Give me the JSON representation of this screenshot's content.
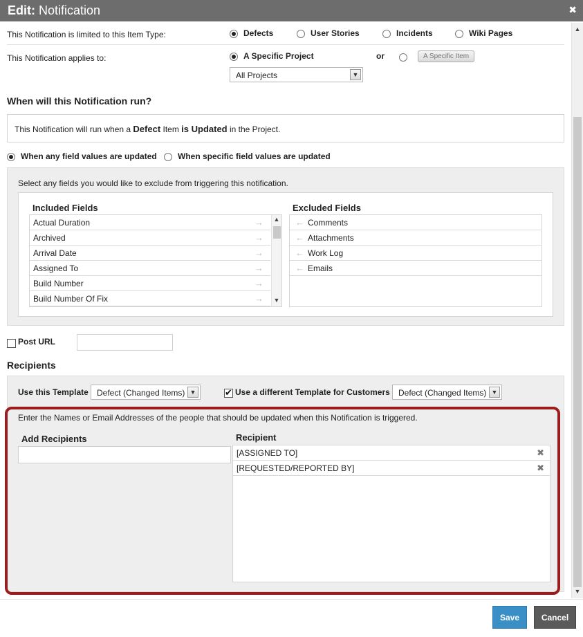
{
  "dialog": {
    "title_prefix": "Edit:",
    "title_main": "Notification",
    "close_glyph": "✖"
  },
  "item_type": {
    "label": "This Notification is limited to this Item Type:",
    "options": [
      {
        "label": "Defects",
        "selected": true
      },
      {
        "label": "User Stories",
        "selected": false
      },
      {
        "label": "Incidents",
        "selected": false
      },
      {
        "label": "Wiki Pages",
        "selected": false
      }
    ]
  },
  "applies_to": {
    "label": "This Notification applies to:",
    "specific_project": "A Specific Project",
    "or": "or",
    "specific_item_button": "A Specific Item",
    "project_select_value": "All Projects"
  },
  "when": {
    "heading": "When will this Notification run?",
    "summary_pre": "This Notification will run when a ",
    "summary_item": "Defect",
    "summary_mid": " Item ",
    "summary_event": "is Updated",
    "summary_post": " in the  Project.",
    "option_any": "When any field values are updated",
    "option_specific": "When specific field values are updated"
  },
  "fields": {
    "instructions": "Select any fields you would like to exclude from triggering this notification.",
    "included_heading": "Included Fields",
    "excluded_heading": "Excluded Fields",
    "included": [
      "Actual Duration",
      "Archived",
      "Arrival Date",
      "Assigned To",
      "Build Number",
      "Build Number Of Fix"
    ],
    "excluded": [
      "Comments",
      "Attachments",
      "Work Log",
      "Emails"
    ],
    "arrow_right": "→",
    "arrow_left": "←"
  },
  "post_url": {
    "label": "Post URL",
    "value": ""
  },
  "recipients": {
    "heading": "Recipients",
    "template_label": "Use this Template",
    "template_value": "Defect (Changed Items)",
    "customer_template_label": "Use a different Template for Customers",
    "customer_template_value": "Defect (Changed Items)",
    "instructions": "Enter the Names or Email Addresses of the people that should be updated when this Notification is triggered.",
    "add_heading": "Add Recipients",
    "list_heading": "Recipient",
    "list": [
      "[ASSIGNED TO]",
      "[REQUESTED/REPORTED BY]"
    ],
    "remove_glyph": "✖"
  },
  "footer": {
    "save": "Save",
    "cancel": "Cancel"
  },
  "colors": {
    "titlebar": "#6d6d6d",
    "save": "#3a8fc6",
    "cancel": "#5a5a5a",
    "highlight": "#9b1c1c"
  }
}
